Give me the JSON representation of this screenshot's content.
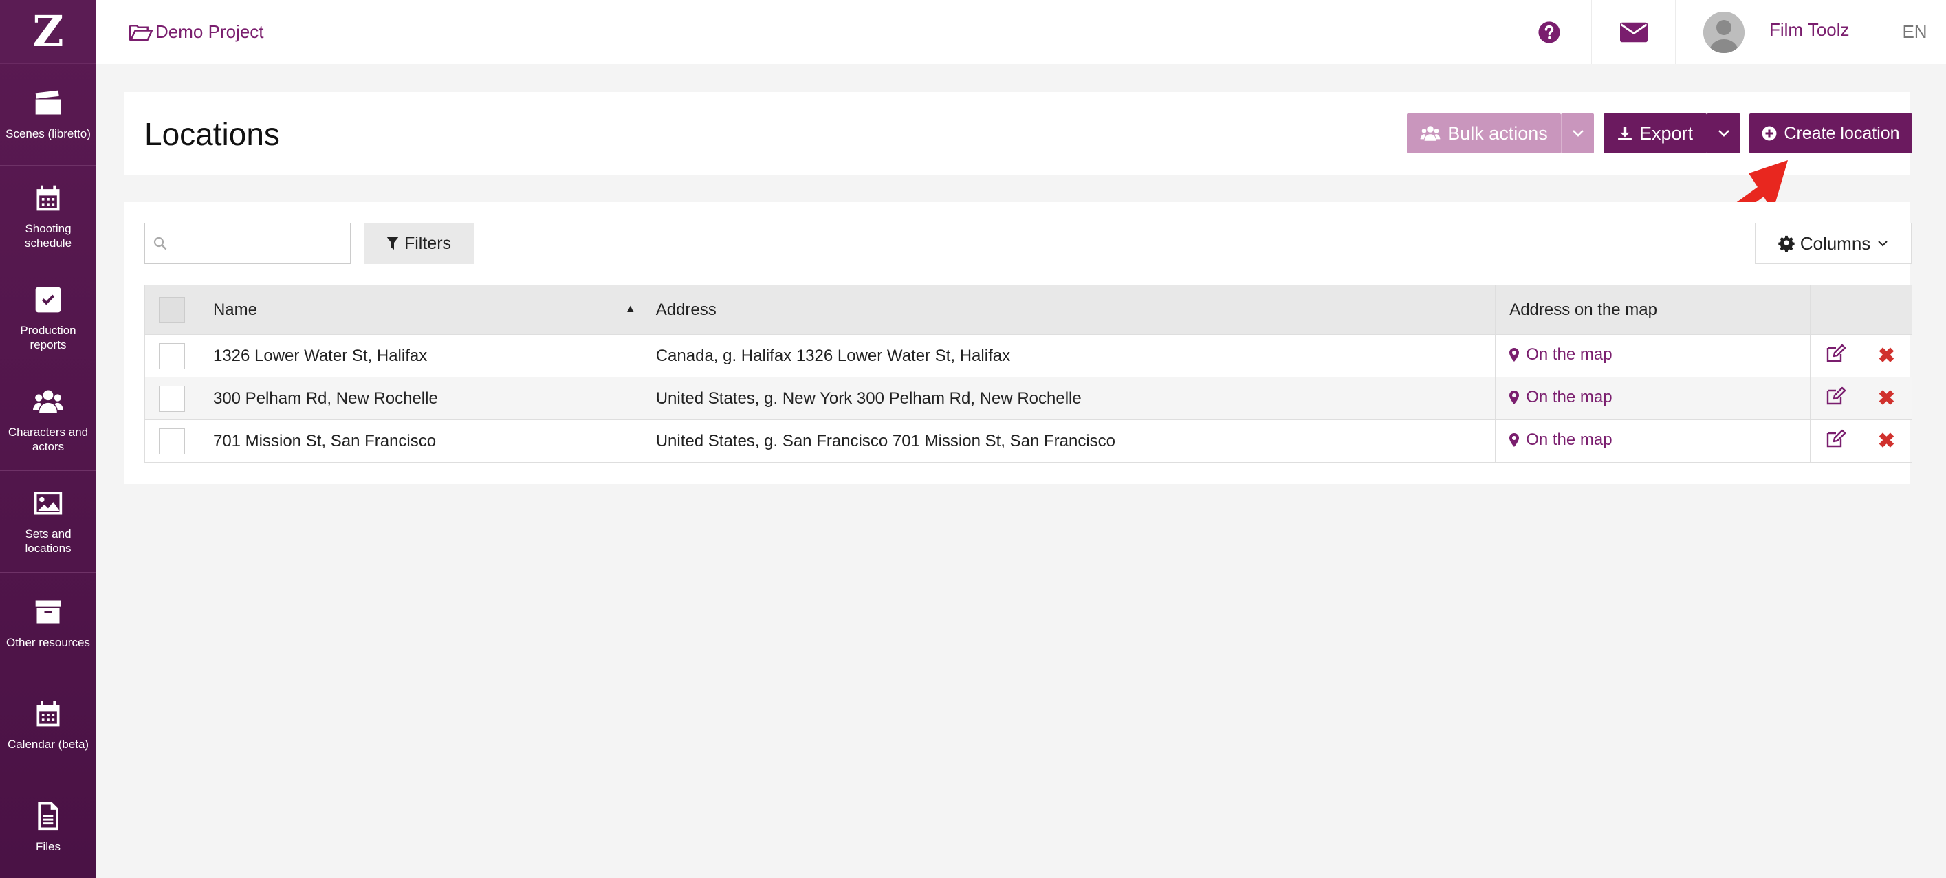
{
  "sidebar": {
    "logo": "Z",
    "items": [
      {
        "label": "Scenes (libretto)",
        "icon": "clapperboard-icon"
      },
      {
        "label": "Shooting schedule",
        "icon": "calendar-icon"
      },
      {
        "label": "Production reports",
        "icon": "checkbox-icon"
      },
      {
        "label": "Characters and actors",
        "icon": "users-icon"
      },
      {
        "label": "Sets and locations",
        "icon": "image-icon"
      },
      {
        "label": "Other resources",
        "icon": "archive-icon"
      },
      {
        "label": "Calendar (beta)",
        "icon": "calendar-icon"
      },
      {
        "label": "Files",
        "icon": "file-icon"
      }
    ]
  },
  "topbar": {
    "project": "Demo Project",
    "user_name": "Film Toolz",
    "language": "EN"
  },
  "page": {
    "title": "Locations",
    "bulk_actions": "Bulk actions",
    "export": "Export",
    "create": "Create location"
  },
  "toolbar": {
    "search_placeholder": "",
    "filters": "Filters",
    "columns": "Columns"
  },
  "table": {
    "headers": [
      "Name",
      "Address",
      "Address on the map"
    ],
    "rows": [
      {
        "name": "1326 Lower Water St, Halifax",
        "address": "Canada, g. Halifax 1326 Lower Water St, Halifax",
        "map": "On the map"
      },
      {
        "name": "300 Pelham Rd, New Rochelle",
        "address": "United States, g. New York 300 Pelham Rd, New Rochelle",
        "map": "On the map"
      },
      {
        "name": "701 Mission St, San Francisco",
        "address": "United States, g. San Francisco 701 Mission St, San Francisco",
        "map": "On the map"
      }
    ]
  },
  "colors": {
    "brand": "#6b1a5f",
    "sidebar": "#5a1a52",
    "bulk_disabled": "#c996bd",
    "delete": "#d0312d",
    "annotation": "#e8271f"
  }
}
